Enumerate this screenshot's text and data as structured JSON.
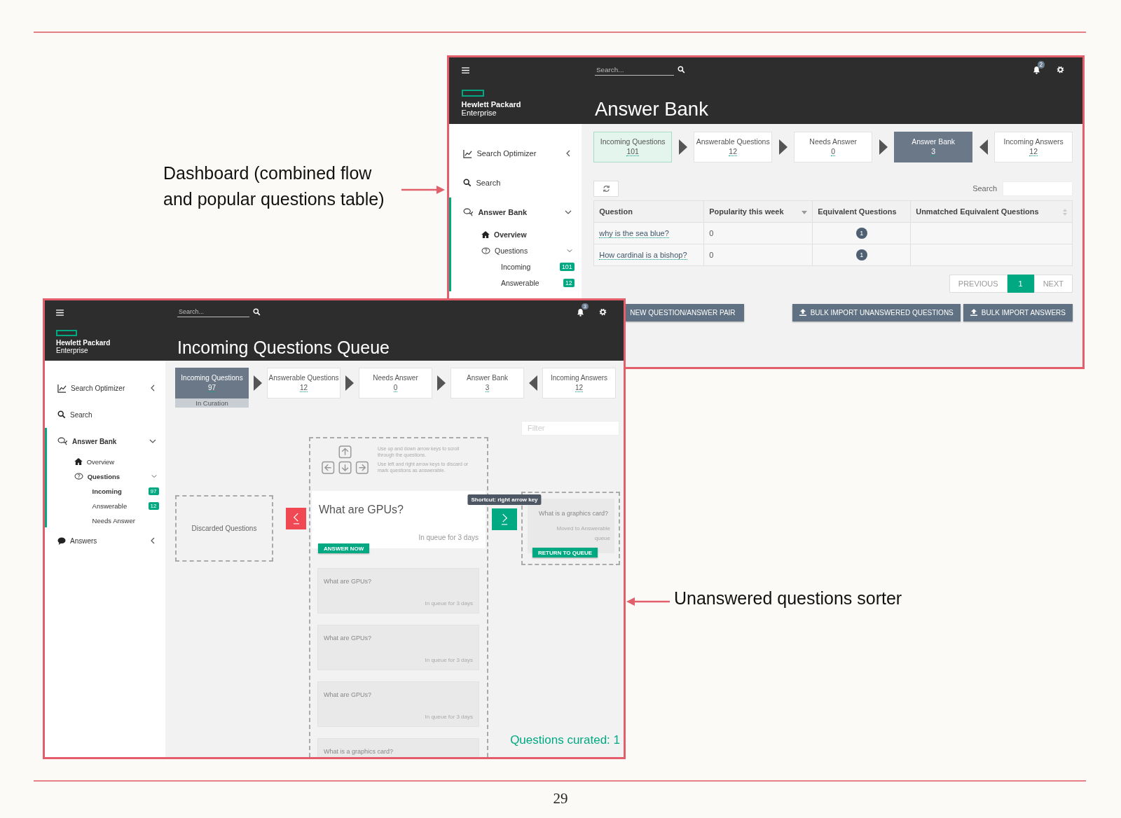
{
  "page": {
    "page_number": "29"
  },
  "annotations": [
    {
      "text": "Dashboard (combined flow\nand popular questions table)",
      "points_left": false
    },
    {
      "text": "Unanswered questions sorter",
      "points_left": true
    }
  ],
  "dashboard_window": {
    "search_placeholder": "Search...",
    "notification_count": "2",
    "brand": [
      "Hewlett Packard",
      "Enterprise"
    ],
    "title": "Answer Bank",
    "sidebar": [
      {
        "label": "Search Optimizer",
        "selected": false,
        "expanded": false
      },
      {
        "label": "Search",
        "selected": false
      },
      {
        "label": "Answer Bank",
        "selected": true,
        "expanded": true,
        "children": [
          {
            "label": "Overview",
            "selected": true
          },
          {
            "label": "Questions",
            "selected": false,
            "expanded": true,
            "children": [
              {
                "label": "Incoming",
                "selected": false,
                "count": "101"
              },
              {
                "label": "Answerable",
                "selected": false,
                "count": "12"
              }
            ]
          }
        ]
      }
    ],
    "flow": [
      {
        "label": "Incoming Questions",
        "count": "101",
        "selected": false,
        "highlighted": true
      },
      {
        "label": "Answerable Questions",
        "count": "12",
        "selected": false,
        "highlighted": false,
        "reverse": false
      },
      {
        "label": "Needs Answer",
        "count": "0",
        "selected": false,
        "highlighted": false,
        "reverse": false
      },
      {
        "label": "Answer Bank",
        "count": "3",
        "selected": true,
        "highlighted": false,
        "reverse": false
      },
      {
        "label": "Incoming Answers",
        "count": "12",
        "selected": false,
        "highlighted": false,
        "reverse": true
      }
    ],
    "table": {
      "search_label": "Search",
      "columns": [
        {
          "label": "Question"
        },
        {
          "label": "Popularity this week",
          "sorted": true
        },
        {
          "label": "Equivalent Questions"
        },
        {
          "label": "Unmatched Equivalent Questions",
          "sorted": false
        }
      ],
      "rows": [
        {
          "question": "why is the sea blue?",
          "popularity": "0",
          "equivalent": "1"
        },
        {
          "question": "How cardinal is a bishop?",
          "popularity": "0",
          "equivalent": "1"
        }
      ]
    },
    "pagination": {
      "previous": "PREVIOUS",
      "pages": [
        {
          "label": "1",
          "selected": true
        }
      ],
      "next": "NEXT"
    },
    "buttons": [
      {
        "label": "NEW QUESTION/ANSWER PAIR",
        "kind": "plain"
      },
      {
        "label": "BULK IMPORT UNANSWERED QUESTIONS",
        "kind": "upload"
      },
      {
        "label": "BULK IMPORT ANSWERS",
        "kind": "upload"
      }
    ]
  },
  "queue_window": {
    "search_placeholder": "Search...",
    "notification_count": "3",
    "brand": [
      "Hewlett Packard",
      "Enterprise"
    ],
    "title": "Incoming Questions Queue",
    "sidebar": [
      {
        "label": "Search Optimizer",
        "selected": false,
        "expanded": false
      },
      {
        "label": "Search",
        "selected": false
      },
      {
        "label": "Answer Bank",
        "selected": true,
        "expanded": true,
        "children": [
          {
            "label": "Overview",
            "selected": false
          },
          {
            "label": "Questions",
            "selected": true,
            "expanded": true,
            "children": [
              {
                "label": "Incoming",
                "selected": true,
                "count": "97"
              },
              {
                "label": "Answerable",
                "selected": false,
                "count": "12"
              },
              {
                "label": "Needs Answer",
                "selected": false
              }
            ]
          }
        ]
      },
      {
        "label": "Answers",
        "selected": false,
        "expanded": false
      }
    ],
    "flow": [
      {
        "label": "Incoming Questions",
        "count": "97",
        "selected": true,
        "highlighted": false,
        "status": "In Curation"
      },
      {
        "label": "Answerable Questions",
        "count": "12",
        "selected": false,
        "highlighted": false,
        "reverse": false
      },
      {
        "label": "Needs Answer",
        "count": "0",
        "selected": false,
        "highlighted": false,
        "reverse": false
      },
      {
        "label": "Answer Bank",
        "count": "3",
        "selected": false,
        "highlighted": false,
        "reverse": false
      },
      {
        "label": "Incoming Answers",
        "count": "12",
        "selected": false,
        "highlighted": false,
        "reverse": true
      }
    ],
    "filter_placeholder": "Filter",
    "sorter": {
      "discarded_label": "Discarded Questions",
      "help": [
        "Use up and down arrow keys to scroll through the questions.",
        "Use left and right arrow keys to discard or mark questions as answerable."
      ],
      "current": {
        "question": "What are GPUs?",
        "age": "In queue for 3 days",
        "action": "ANSWER NOW"
      },
      "queue": [
        {
          "question": "What are GPUs?",
          "age": "In queue for 3 days"
        },
        {
          "question": "What are GPUs?",
          "age": "In queue for 3 days"
        },
        {
          "question": "What are GPUs?",
          "age": "In queue for 3 days"
        },
        {
          "question": "What is a graphics card?"
        }
      ],
      "tooltip": "Shortcut: right arrow key",
      "answerable": [
        {
          "question": "What is a graphics card?",
          "note": "Moved to Answerable queue",
          "action": "RETURN TO QUEUE"
        }
      ],
      "curated": "Questions curated: 1"
    }
  }
}
